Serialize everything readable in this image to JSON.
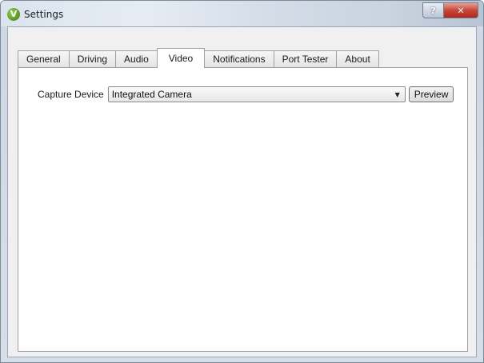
{
  "window": {
    "title": "Settings",
    "app_icon": "v-logo-icon",
    "help_label": "?",
    "close_label": "✕"
  },
  "tabs": [
    {
      "label": "General",
      "active": false
    },
    {
      "label": "Driving",
      "active": false
    },
    {
      "label": "Audio",
      "active": false
    },
    {
      "label": "Video",
      "active": true
    },
    {
      "label": "Notifications",
      "active": false
    },
    {
      "label": "Port Tester",
      "active": false
    },
    {
      "label": "About",
      "active": false
    }
  ],
  "video": {
    "capture_label": "Capture Device",
    "capture_value": "Integrated Camera",
    "preview_label": "Preview"
  },
  "colors": {
    "close_button": "#c7463a",
    "app_icon": "#5aa12a"
  }
}
